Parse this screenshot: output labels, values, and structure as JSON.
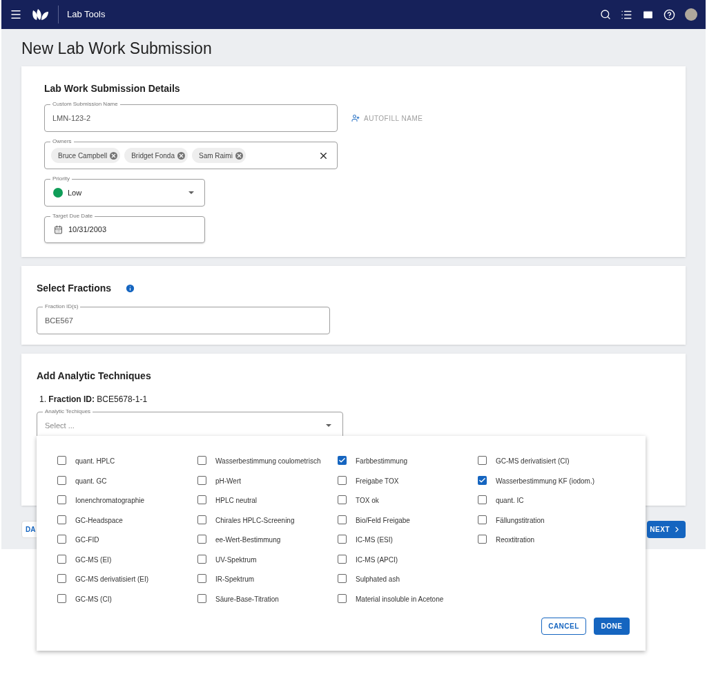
{
  "app_bar": {
    "title": "Lab Tools"
  },
  "page_title": "New Lab Work Submission",
  "details": {
    "heading": "Lab Work Submission Details",
    "name_field": {
      "label": "Custom Submission Name",
      "value": "LMN-123-2"
    },
    "autofill_button": "AUTOFILL NAME",
    "owners": {
      "label": "Owners",
      "chips": [
        "Bruce Campbell",
        "Bridget Fonda",
        "Sam Raimi"
      ]
    },
    "priority": {
      "label": "Priority",
      "value": "Low",
      "color": "#0f9d58"
    },
    "due_date": {
      "label": "Target Due Date",
      "value": "10/31/2003"
    }
  },
  "fractions": {
    "heading": "Select Fractions",
    "field": {
      "label": "Fraction ID(s)",
      "value": "BCE567"
    }
  },
  "techniques": {
    "heading": "Add Analytic Techniques",
    "fraction_line": "1. **Fraction ID:** BCE5678-1-1",
    "select": {
      "label": "Analytic Techiques",
      "placeholder": "Select ..."
    }
  },
  "footer": {
    "back_button": "DA",
    "next_button": "NEXT"
  },
  "dropdown": {
    "columns": [
      [
        {
          "label": "quant. HPLC",
          "checked": false
        },
        {
          "label": "quant. GC",
          "checked": false
        },
        {
          "label": "Ionenchromatographie",
          "checked": false
        },
        {
          "label": "GC-Headspace",
          "checked": false
        },
        {
          "label": "GC-FID",
          "checked": false
        },
        {
          "label": "GC-MS (EI)",
          "checked": false
        },
        {
          "label": "GC-MS derivatisiert (EI)",
          "checked": false
        },
        {
          "label": "GC-MS (CI)",
          "checked": false
        }
      ],
      [
        {
          "label": "Wasserbestimmung coulometrisch",
          "checked": false
        },
        {
          "label": "pH-Wert",
          "checked": false
        },
        {
          "label": "HPLC neutral",
          "checked": false
        },
        {
          "label": "Chirales HPLC-Screening",
          "checked": false
        },
        {
          "label": "ee-Wert-Bestimmung",
          "checked": false
        },
        {
          "label": "UV-Spektrum",
          "checked": false
        },
        {
          "label": "IR-Spektrum",
          "checked": false
        },
        {
          "label": "Säure-Base-Titration",
          "checked": false
        }
      ],
      [
        {
          "label": "Farbbestimmung",
          "checked": true
        },
        {
          "label": "Freigabe TOX",
          "checked": false
        },
        {
          "label": "TOX ok",
          "checked": false
        },
        {
          "label": "Bio/Feld Freigabe",
          "checked": false
        },
        {
          "label": "IC-MS (ESI)",
          "checked": false
        },
        {
          "label": "IC-MS (APCI)",
          "checked": false
        },
        {
          "label": "Sulphated ash",
          "checked": false
        },
        {
          "label": "Material insoluble in Acetone",
          "checked": false
        }
      ],
      [
        {
          "label": "GC-MS derivatisiert (CI)",
          "checked": false
        },
        {
          "label": "Wasserbestimmung KF (iodom.)",
          "checked": true
        },
        {
          "label": "quant. IC",
          "checked": false
        },
        {
          "label": "Fällungstitration",
          "checked": false
        },
        {
          "label": "Reoxtitration",
          "checked": false
        }
      ]
    ],
    "cancel_button": "CANCEL",
    "done_button": "DONE"
  }
}
